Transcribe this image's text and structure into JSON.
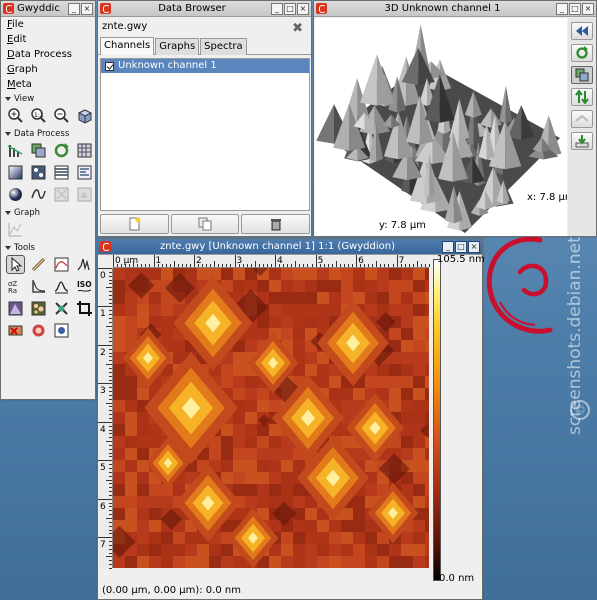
{
  "toolbox": {
    "title": "Gwyddic",
    "menu": [
      {
        "label_u": "F",
        "label_rest": "ile"
      },
      {
        "label_u": "E",
        "label_rest": "dit"
      },
      {
        "label_u": "D",
        "label_rest": "ata Process"
      },
      {
        "label_u": "G",
        "label_rest": "raph"
      },
      {
        "label_u": "M",
        "label_rest": "eta"
      }
    ],
    "sections": {
      "view": "View",
      "data_process": "Data Process",
      "graph": "Graph",
      "tools": "Tools"
    },
    "view_icons": [
      "zoom-in-icon",
      "zoom-1-1-icon",
      "zoom-out-icon",
      "3d-view-icon"
    ],
    "data_process_icons": [
      "level-icon",
      "crop-icon",
      "rotate-icon",
      "grid-icon",
      "gradient-icon",
      "fix-zero-icon",
      "stripes-icon",
      "filter-icon",
      "sphere-icon",
      "wave-icon",
      "disabled-icon",
      "disabled-icon"
    ],
    "graph_icons": [
      "graph-fit-icon"
    ],
    "tool_icons": [
      "pointer-icon",
      "ruler-icon",
      "profile-icon",
      "spectro-icon",
      "stats-icon",
      "line-icon",
      "filter-tool-icon",
      "iso-icon",
      "polygon-icon",
      "grain-icon",
      "grain-select-icon",
      "crop-tool-icon",
      "mask-remove-icon",
      "mask-tool-icon",
      "spot-icon"
    ]
  },
  "data_browser": {
    "title": "Data Browser",
    "file_name": "znte.gwy",
    "tabs": [
      "Channels",
      "Graphs",
      "Spectra"
    ],
    "channels": [
      {
        "label": "Unknown channel 1",
        "checked": true
      }
    ]
  },
  "view3d": {
    "title": "3D Unknown channel 1",
    "x_label": "x: 7.8 µm",
    "y_label": "y: 7.8 µm",
    "side_buttons": [
      "rewind-icon",
      "refresh-icon",
      "layers-icon",
      "arrows-icon",
      "disabled-arrows-icon",
      "download-icon"
    ]
  },
  "data_window": {
    "title": "znte.gwy [Unknown channel 1] 1:1 (Gwyddion)",
    "top_ruler": [
      "0 µm",
      "1",
      "2",
      "3",
      "4",
      "5",
      "6",
      "7"
    ],
    "left_ruler": [
      "0",
      "1",
      "2",
      "3",
      "4",
      "5",
      "6",
      "7"
    ],
    "colorbar_max": "105.5 nm",
    "colorbar_min": "0.0 nm",
    "status": "(0.00 µm, 0.00 µm): 0.0 nm"
  },
  "desktop": {
    "watermark": "screenshots.debian.net",
    "watermark_mark": "©"
  },
  "colors": {
    "title_active": "#3a679b",
    "gwyddion_icon": "#d9341b",
    "selection": "#5a86bd",
    "debian_red": "#c8102e"
  }
}
